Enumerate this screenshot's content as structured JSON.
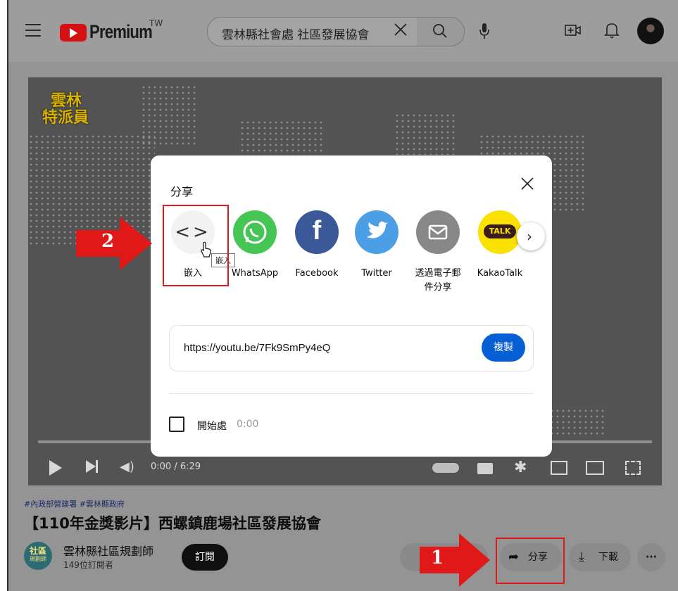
{
  "header": {
    "logo_text": "Premium",
    "region": "TW",
    "search_value": "雲林縣社會處 社區發展協會",
    "search_clear": "╳"
  },
  "player": {
    "overlay_line1": "雲林",
    "overlay_line2": "特派員",
    "time": "0:00 / 6:29",
    "progress": 0.0
  },
  "share_dialog": {
    "title": "分享",
    "options": [
      {
        "label": "嵌入",
        "icon": "embed-icon",
        "color": "#f2f2f2"
      },
      {
        "label": "WhatsApp",
        "icon": "whatsapp-icon",
        "color": "#45c554"
      },
      {
        "label": "Facebook",
        "icon": "facebook-icon",
        "color": "#3b5998"
      },
      {
        "label": "Twitter",
        "icon": "twitter-icon",
        "color": "#4c9ee6"
      },
      {
        "label": "透過電子郵件分享",
        "label_line1": "透過電子郵",
        "label_line2": "件分享",
        "icon": "email-icon",
        "color": "#888888"
      },
      {
        "label": "KakaoTalk",
        "icon": "kakaotalk-icon",
        "color": "#fae100",
        "badge": "TALK"
      }
    ],
    "tooltip": "嵌入",
    "link": "https://youtu.be/7Fk9SmPy4eQ",
    "copy_label": "複製",
    "start_label": "開始處",
    "start_time": "0:00"
  },
  "video_info": {
    "hashtags": "#內政部營建署 #雲林縣政府",
    "title": "【110年金獎影片】西螺鎮鹿場社區發展協會",
    "channel_name": "雲林縣社區規劃師",
    "channel_avatar_line1": "社區",
    "channel_avatar_line2": "規劃師",
    "subscribers": "149位訂閱者",
    "subscribe_label": "訂閱",
    "share_label": "分享",
    "download_label": "下載",
    "more_label": "···"
  },
  "annotations": {
    "arrow_1": "1",
    "arrow_2": "2",
    "accent": "#e01818"
  }
}
